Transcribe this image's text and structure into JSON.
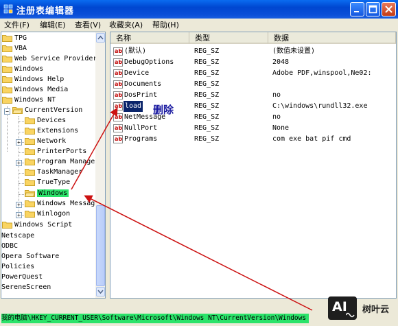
{
  "window": {
    "title": "注册表编辑器"
  },
  "menu": [
    "文件(F)",
    "编辑(E)",
    "查看(V)",
    "收藏夹(A)",
    "帮助(H)"
  ],
  "tree": {
    "items": [
      {
        "label": "TPG"
      },
      {
        "label": "VBA"
      },
      {
        "label": "Web Service Providers"
      },
      {
        "label": "Windows"
      },
      {
        "label": "Windows Help"
      },
      {
        "label": "Windows Media"
      },
      {
        "label": "Windows NT"
      },
      {
        "label": "CurrentVersion"
      },
      {
        "label": "Devices"
      },
      {
        "label": "Extensions"
      },
      {
        "label": "Network"
      },
      {
        "label": "PrinterPorts"
      },
      {
        "label": "Program Manager"
      },
      {
        "label": "TaskManager"
      },
      {
        "label": "TrueType"
      },
      {
        "label": "Windows"
      },
      {
        "label": "Windows Messaging"
      },
      {
        "label": "Winlogon"
      },
      {
        "label": "Windows Script"
      },
      {
        "label": "Netscape"
      },
      {
        "label": "ODBC"
      },
      {
        "label": "Opera Software"
      },
      {
        "label": "Policies"
      },
      {
        "label": "PowerQuest"
      },
      {
        "label": "SereneScreen"
      }
    ]
  },
  "list": {
    "columns": [
      "名称",
      "类型",
      "数据"
    ],
    "rows": [
      {
        "name": "(默认)",
        "type": "REG_SZ",
        "data": "(数值未设置)"
      },
      {
        "name": "DebugOptions",
        "type": "REG_SZ",
        "data": "2048"
      },
      {
        "name": "Device",
        "type": "REG_SZ",
        "data": "Adobe PDF,winspool,Ne02:"
      },
      {
        "name": "Documents",
        "type": "REG_SZ",
        "data": ""
      },
      {
        "name": "DosPrint",
        "type": "REG_SZ",
        "data": "no"
      },
      {
        "name": "load",
        "type": "REG_SZ",
        "data": "C:\\windows\\rundll32.exe"
      },
      {
        "name": "NetMessage",
        "type": "REG_SZ",
        "data": "no"
      },
      {
        "name": "NullPort",
        "type": "REG_SZ",
        "data": "None"
      },
      {
        "name": "Programs",
        "type": "REG_SZ",
        "data": "com exe bat pif cmd"
      }
    ]
  },
  "annotation": {
    "delete_label": "删除"
  },
  "status": {
    "path": "我的电脑\\HKEY_CURRENT_USER\\Software\\Microsoft\\Windows NT\\CurrentVersion\\Windows"
  },
  "watermark": {
    "logo": "AI",
    "text": "树叶云"
  },
  "colors": {
    "highlight": "#2be36a",
    "arrow": "#cc1111",
    "title_bar": "#0046d0"
  },
  "icons": [
    "registry-app-icon",
    "minimize-icon",
    "maximize-icon",
    "close-icon",
    "folder-icon",
    "string-value-icon"
  ]
}
